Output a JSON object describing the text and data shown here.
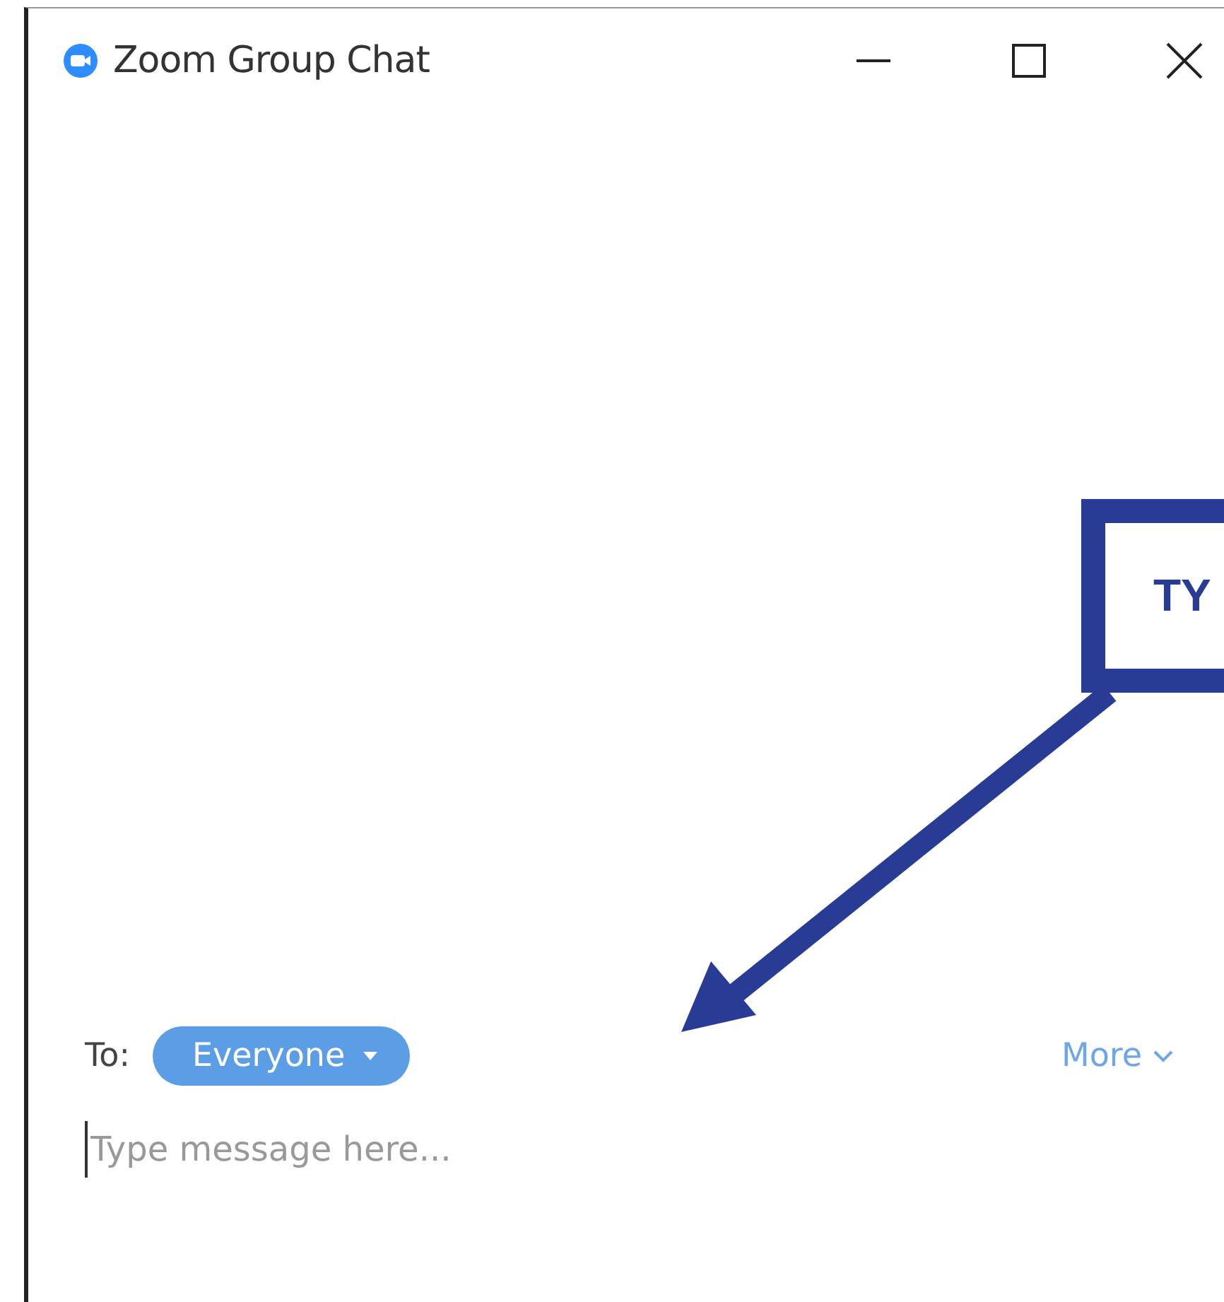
{
  "window": {
    "title": "Zoom Group Chat"
  },
  "callout": {
    "text": "TY"
  },
  "compose": {
    "to_label": "To:",
    "recipient": "Everyone",
    "more": "More",
    "placeholder": "Type message here..."
  }
}
